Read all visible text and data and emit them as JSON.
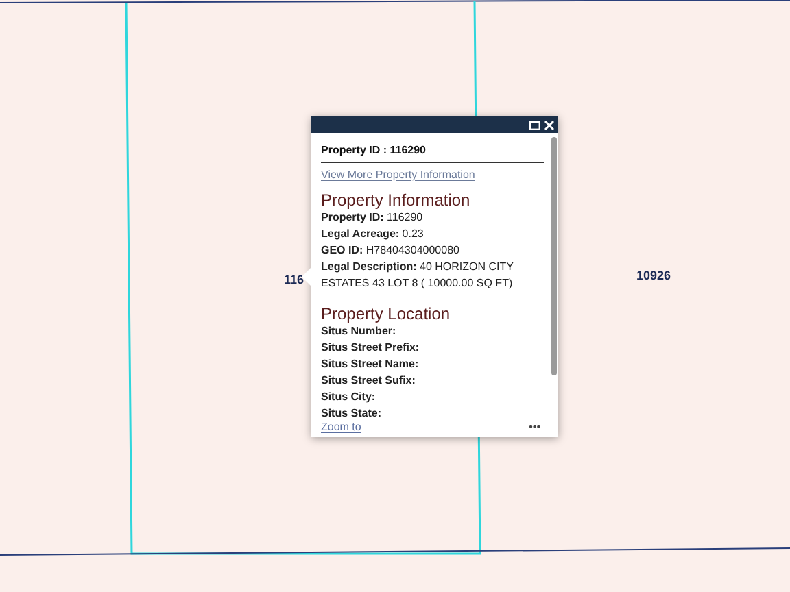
{
  "map": {
    "parcel_labels": [
      {
        "text": "116"
      },
      {
        "text": "10926"
      }
    ]
  },
  "popup": {
    "title": "Property ID : 116290",
    "link": "View More Property Information",
    "sections": [
      {
        "heading": "Property Information",
        "fields": [
          {
            "label": "Property ID:",
            "value": "116290"
          },
          {
            "label": "Legal Acreage:",
            "value": "0.23"
          },
          {
            "label": "GEO ID:",
            "value": "H78404304000080"
          },
          {
            "label": "Legal Description:",
            "value": "40 HORIZON CITY ESTATES 43 LOT 8 ( 10000.00 SQ FT)"
          }
        ]
      },
      {
        "heading": "Property Location",
        "fields": [
          {
            "label": "Situs Number:"
          },
          {
            "label": "Situs Street Prefix:"
          },
          {
            "label": "Situs Street Name:"
          },
          {
            "label": "Situs Street Sufix:"
          },
          {
            "label": "Situs City:"
          },
          {
            "label": "Situs State:"
          }
        ]
      }
    ],
    "zoom_link": "Zoom to",
    "more": "•••"
  }
}
